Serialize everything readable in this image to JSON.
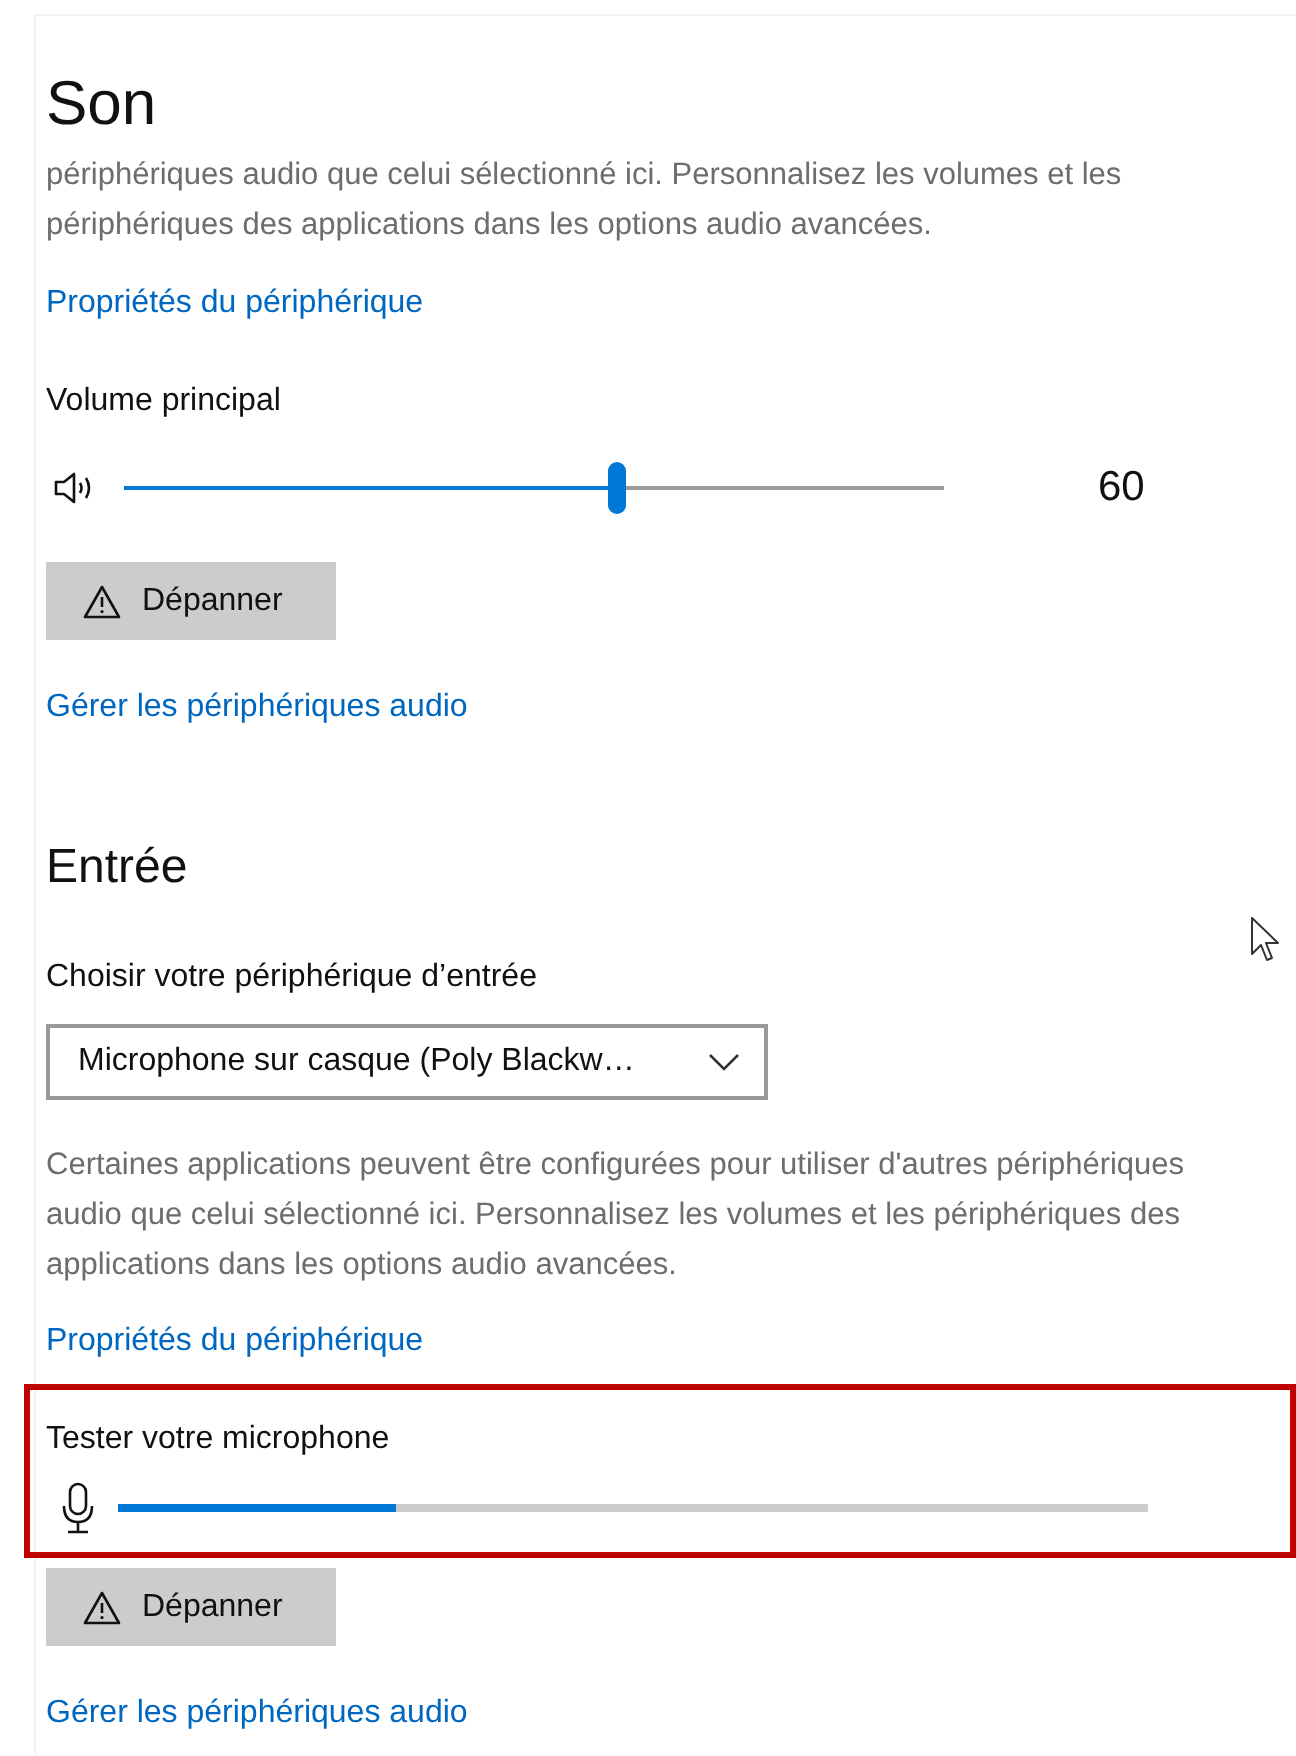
{
  "title": "Son",
  "output": {
    "description": "périphériques audio que celui sélectionné ici. Personnalisez les volumes et les périphériques des applications dans les options audio avancées.",
    "properties_link": "Propriétés du périphérique",
    "volume": {
      "label": "Volume principal",
      "level": 0.6,
      "reading": "60"
    },
    "troubleshoot_button": "Dépanner",
    "manage_link": "Gérer les périphériques audio"
  },
  "input": {
    "heading": "Entrée",
    "device_label": "Choisir votre périphérique d’entrée",
    "device_value": "Microphone sur casque (Poly Blackw…",
    "description": "Certaines applications peuvent être configurées pour utiliser d'autres périphériques audio que celui sélectionné ici. Personnalisez les volumes et les périphériques des applications dans les options audio avancées.",
    "properties_link": "Propriétés du périphérique",
    "test": {
      "label": "Tester votre microphone",
      "level": 0.27,
      "highlighted": true
    },
    "troubleshoot_button": "Dépanner",
    "manage_link": "Gérer les périphériques audio"
  }
}
